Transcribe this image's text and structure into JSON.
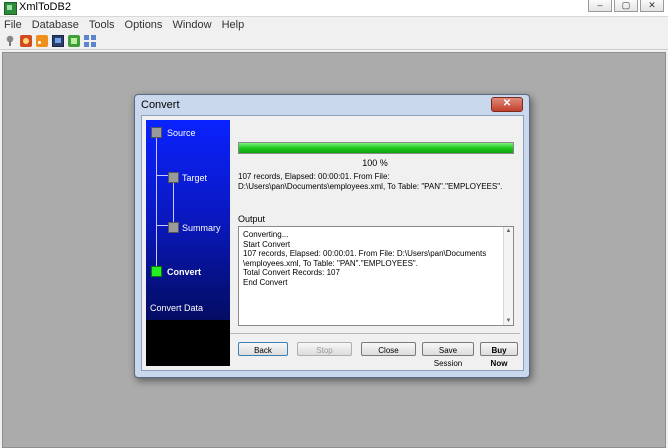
{
  "app": {
    "title": "XmlToDB2",
    "window_controls": [
      "–",
      "▢",
      "✕"
    ]
  },
  "menu": [
    "File",
    "Database",
    "Tools",
    "Options",
    "Window",
    "Help"
  ],
  "toolbar_icons": [
    "pin-icon",
    "database-icon",
    "rss-icon",
    "monitor-icon",
    "green-db-icon",
    "grid-icon"
  ],
  "dialog": {
    "title": "Convert",
    "close_label": "✕",
    "steps": [
      {
        "label": "Source",
        "current": false
      },
      {
        "label": "Target",
        "current": false
      },
      {
        "label": "Summary",
        "current": false
      },
      {
        "label": "Convert",
        "current": true
      }
    ],
    "section_label": "Convert Data",
    "progress": {
      "value": 100,
      "label": "100 %"
    },
    "stats_line1": "107 records,    Elapsed: 00:00:01.    From File:",
    "stats_line2": "D:\\Users\\pan\\Documents\\employees.xml,     To Table: \"PAN\".\"EMPLOYEES\".",
    "output_label": "Output",
    "output_lines": [
      "Converting...",
      "Start Convert",
      "107 records,    Elapsed: 00:00:01.    From File: D:\\Users\\pan\\Documents",
      "\\employees.xml,     To Table: \"PAN\".\"EMPLOYEES\".",
      "Total Convert Records: 107",
      "End Convert"
    ],
    "buttons": {
      "back": "Back",
      "stop": "Stop",
      "close": "Close",
      "save_session": "Save Session",
      "buy_now": "Buy Now"
    }
  }
}
